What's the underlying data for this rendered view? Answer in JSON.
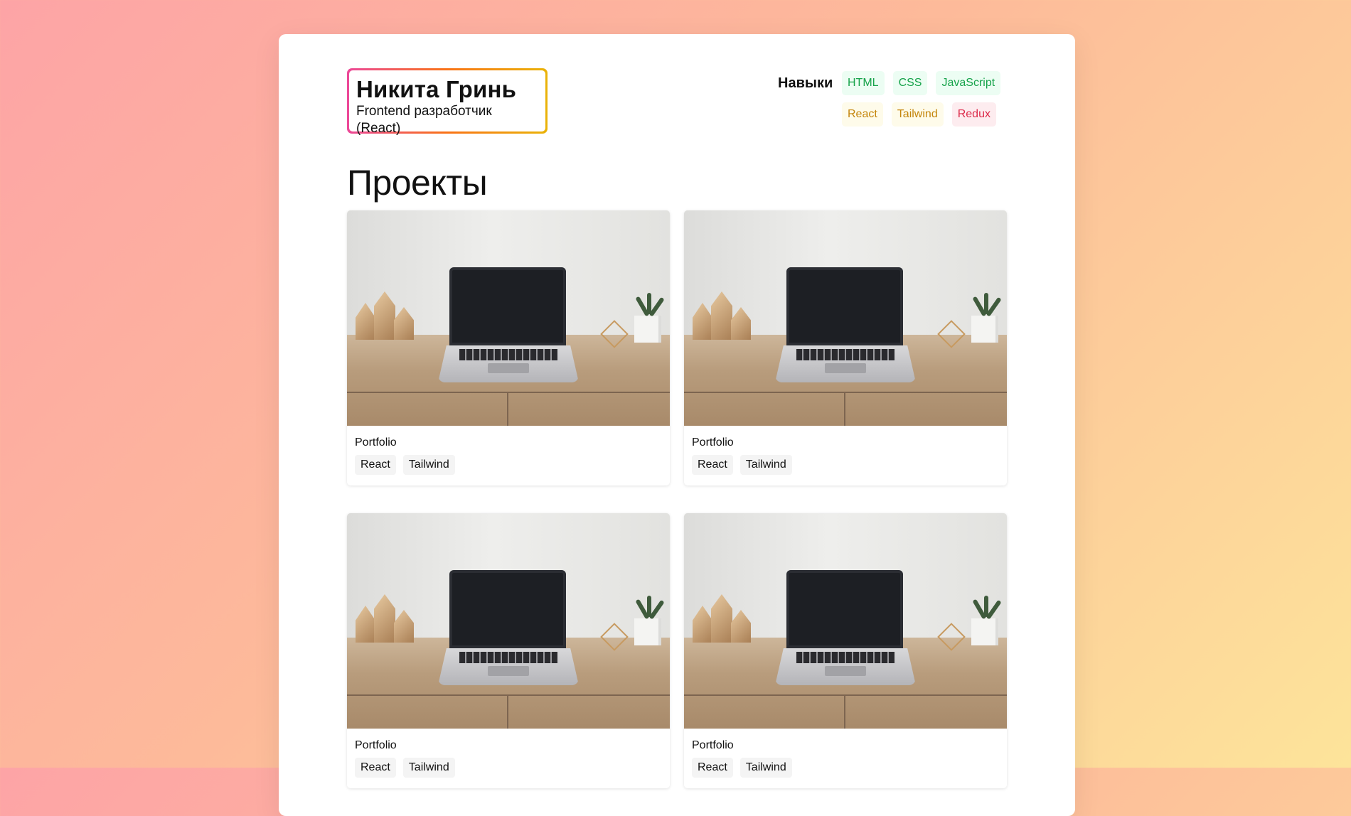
{
  "header": {
    "name": "Никита Гринь",
    "role": "Frontend разработчик (React)"
  },
  "skills": {
    "label": "Навыки",
    "rows": [
      [
        {
          "label": "HTML",
          "color": "#16a34a"
        },
        {
          "label": "CSS",
          "color": "#16a34a"
        },
        {
          "label": "JavaScript",
          "color": "#16a34a"
        }
      ],
      [
        {
          "label": "React",
          "color": "#c4850b"
        },
        {
          "label": "Tailwind",
          "color": "#c4850b"
        },
        {
          "label": "Redux",
          "color": "#dc2b4a"
        }
      ]
    ]
  },
  "projects": {
    "title": "Проекты",
    "items": [
      {
        "title": "Portfolio",
        "tags": [
          "React",
          "Tailwind"
        ],
        "image": "laptop-desk-photo"
      },
      {
        "title": "Portfolio",
        "tags": [
          "React",
          "Tailwind"
        ],
        "image": "laptop-desk-photo"
      },
      {
        "title": "Portfolio",
        "tags": [
          "React",
          "Tailwind"
        ],
        "image": "laptop-desk-photo"
      },
      {
        "title": "Portfolio",
        "tags": [
          "React",
          "Tailwind"
        ],
        "image": "laptop-desk-photo"
      }
    ]
  }
}
